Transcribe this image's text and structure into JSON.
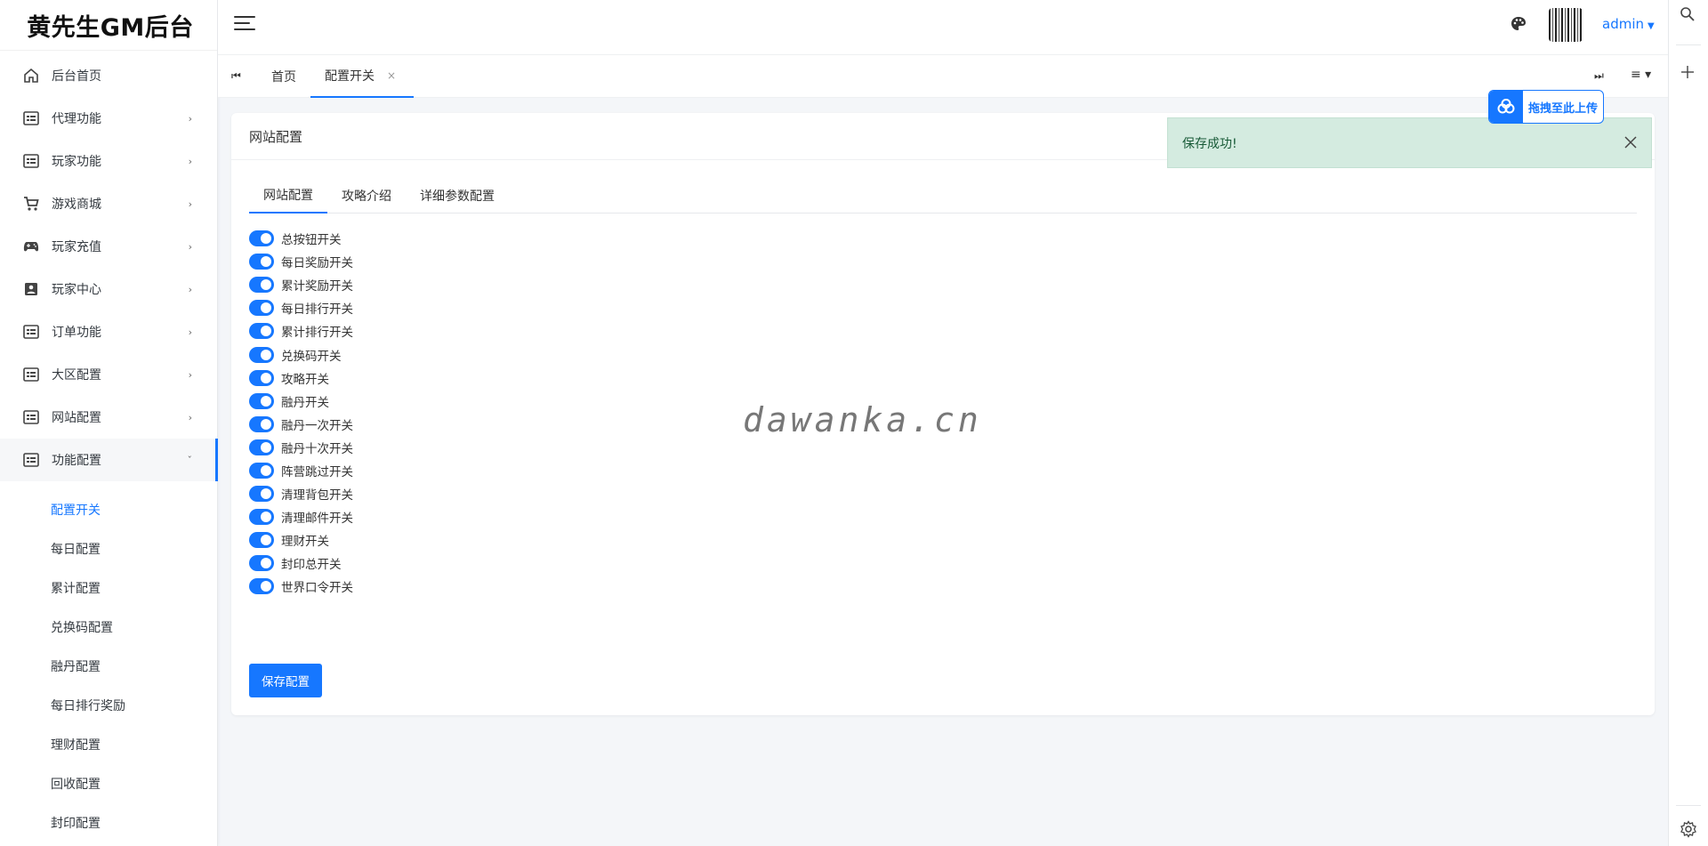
{
  "brand": "黄先生GM后台",
  "sidebar": {
    "items": [
      {
        "label": "后台首页",
        "icon": "home-icon"
      },
      {
        "label": "代理功能",
        "icon": "list-card-icon"
      },
      {
        "label": "玩家功能",
        "icon": "list-card-icon"
      },
      {
        "label": "游戏商城",
        "icon": "cart-icon"
      },
      {
        "label": "玩家充值",
        "icon": "gamepad-icon"
      },
      {
        "label": "玩家中心",
        "icon": "contact-card-icon"
      },
      {
        "label": "订单功能",
        "icon": "list-card-icon"
      },
      {
        "label": "大区配置",
        "icon": "list-card-icon"
      },
      {
        "label": "网站配置",
        "icon": "list-card-icon"
      },
      {
        "label": "功能配置",
        "icon": "list-card-icon"
      }
    ],
    "sub_items": [
      "配置开关",
      "每日配置",
      "累计配置",
      "兑换码配置",
      "融丹配置",
      "每日排行奖励",
      "理财配置",
      "回收配置",
      "封印配置"
    ],
    "active_sub": "配置开关"
  },
  "header": {
    "user": "admin"
  },
  "tabs": {
    "home": "首页",
    "active": "配置开关",
    "close": "×"
  },
  "card": {
    "title": "网站配置",
    "inner_tabs": [
      "网站配置",
      "攻略介绍",
      "详细参数配置"
    ],
    "switches": [
      "总按钮开关",
      "每日奖励开关",
      "累计奖励开关",
      "每日排行开关",
      "累计排行开关",
      "兑换码开关",
      "攻略开关",
      "融丹开关",
      "融丹一次开关",
      "融丹十次开关",
      "阵营跳过开关",
      "清理背包开关",
      "清理邮件开关",
      "理财开关",
      "封印总开关",
      "世界口令开关"
    ],
    "save_label": "保存配置"
  },
  "toast": {
    "message": "保存成功!"
  },
  "upload": {
    "label": "拖拽至此上传"
  },
  "watermark": "dawanka.cn",
  "colors": {
    "accent": "#1677ff",
    "toast_bg": "#d4ebe0"
  }
}
